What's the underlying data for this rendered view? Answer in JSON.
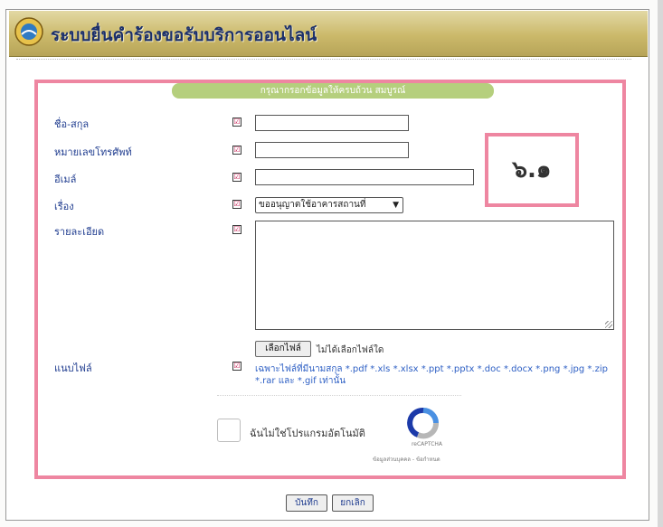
{
  "banner": {
    "title": "ระบบยื่นคำร้องขอรับบริการออนไลน์"
  },
  "form": {
    "header": "กรุณากรอกข้อมูลให้ครบถ้วน สมบูรณ์",
    "required_mark": "☑",
    "fields": {
      "name": {
        "label": "ชื่อ-สกุล",
        "value": ""
      },
      "phone": {
        "label": "หมายเลขโทรศัพท์",
        "value": ""
      },
      "email": {
        "label": "อีเมล์",
        "value": ""
      },
      "subject": {
        "label": "เรื่อง",
        "selected": "ขออนุญาตใช้อาคารสถานที่"
      },
      "details": {
        "label": "รายละเอียด",
        "value": ""
      },
      "attachment": {
        "label": "แนบไฟล์",
        "button": "เลือกไฟล์",
        "status": "ไม่ได้เลือกไฟล์ใด",
        "hint": "เฉพาะไฟล์ที่มีนามสกุล *.pdf *.xls *.xlsx *.ppt *.pptx *.doc *.docx *.png *.jpg *.zip *.rar และ *.gif เท่านั้น"
      }
    },
    "captcha": {
      "label": "ฉันไม่ใช่โปรแกรมอัตโนมัติ",
      "brand": "reCAPTCHA",
      "links": "ข้อมูลส่วนบุคคล - ข้อกำหนด"
    }
  },
  "annotation": {
    "label": "๖.๑"
  },
  "actions": {
    "save": "บันทึก",
    "cancel": "ยกเลิก"
  },
  "colors": {
    "accent_border": "#ee86a1",
    "header_bar": "#b5cf7d",
    "label_text": "#1f3c8f",
    "link_text": "#2d5fc4"
  }
}
